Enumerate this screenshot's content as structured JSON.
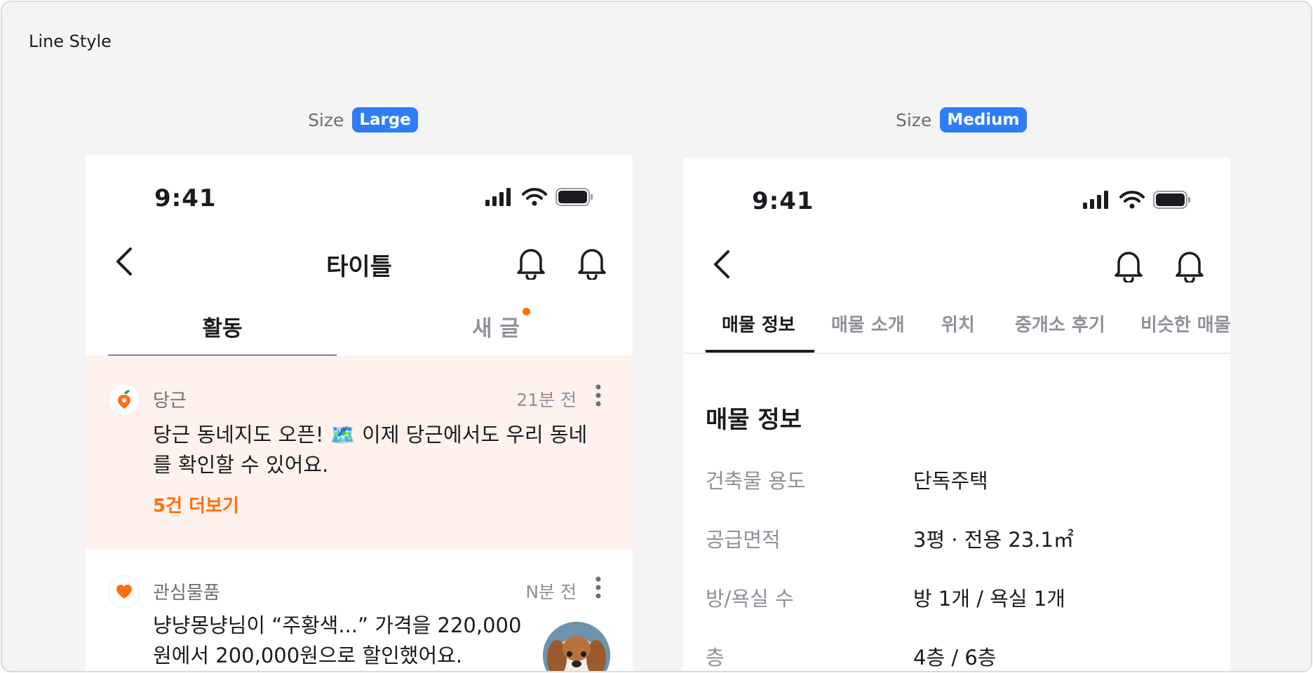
{
  "frame": {
    "title": "Line Style"
  },
  "size_labels": {
    "large": {
      "label": "Size",
      "value": "Large"
    },
    "medium": {
      "label": "Size",
      "value": "Medium"
    }
  },
  "colors": {
    "accent_blue": "#2f7cf6",
    "accent_orange": "#ff6f0f",
    "highlight_bg": "#fff1ec"
  },
  "phone_large": {
    "status": {
      "time": "9:41"
    },
    "nav": {
      "title": "타이틀",
      "icons": [
        "chevron-left-icon",
        "bell-icon",
        "bell-icon"
      ]
    },
    "tabs": [
      {
        "label": "활동",
        "active": true
      },
      {
        "label": "새 글",
        "active": false,
        "has_dot": true
      }
    ],
    "feed": [
      {
        "source": "당근",
        "time": "21분 전",
        "body_line1": "당근 동네지도 오픈! 🗺️ 이제 당근에서도 우리 동네",
        "body_line2": "를 확인할 수 있어요.",
        "link": "5건 더보기",
        "icon": "carrot-icon",
        "highlight": true
      },
      {
        "source": "관심물품",
        "time": "N분 전",
        "body_line1": "냥냥몽냥님이 “주황색...” 가격을 220,000",
        "body_line2": "원에서 200,000원으로 할인했어요.",
        "icon": "heart-icon",
        "thumbnail": "puppy-thumbnail"
      }
    ]
  },
  "phone_medium": {
    "status": {
      "time": "9:41"
    },
    "tabs": [
      {
        "label": "매물 정보",
        "active": true
      },
      {
        "label": "매물 소개",
        "active": false
      },
      {
        "label": "위치",
        "active": false
      },
      {
        "label": "중개소 후기",
        "active": false
      },
      {
        "label": "비슷한 매물",
        "active": false
      }
    ],
    "section_title": "매물 정보",
    "rows": [
      {
        "key": "건축물 용도",
        "value": "단독주택"
      },
      {
        "key": "공급면적",
        "value": "3평 · 전용 23.1㎡"
      },
      {
        "key": "방/욕실 수",
        "value": "방 1개 / 욕실 1개"
      },
      {
        "key": "층",
        "value": "4층 / 6층"
      }
    ]
  }
}
